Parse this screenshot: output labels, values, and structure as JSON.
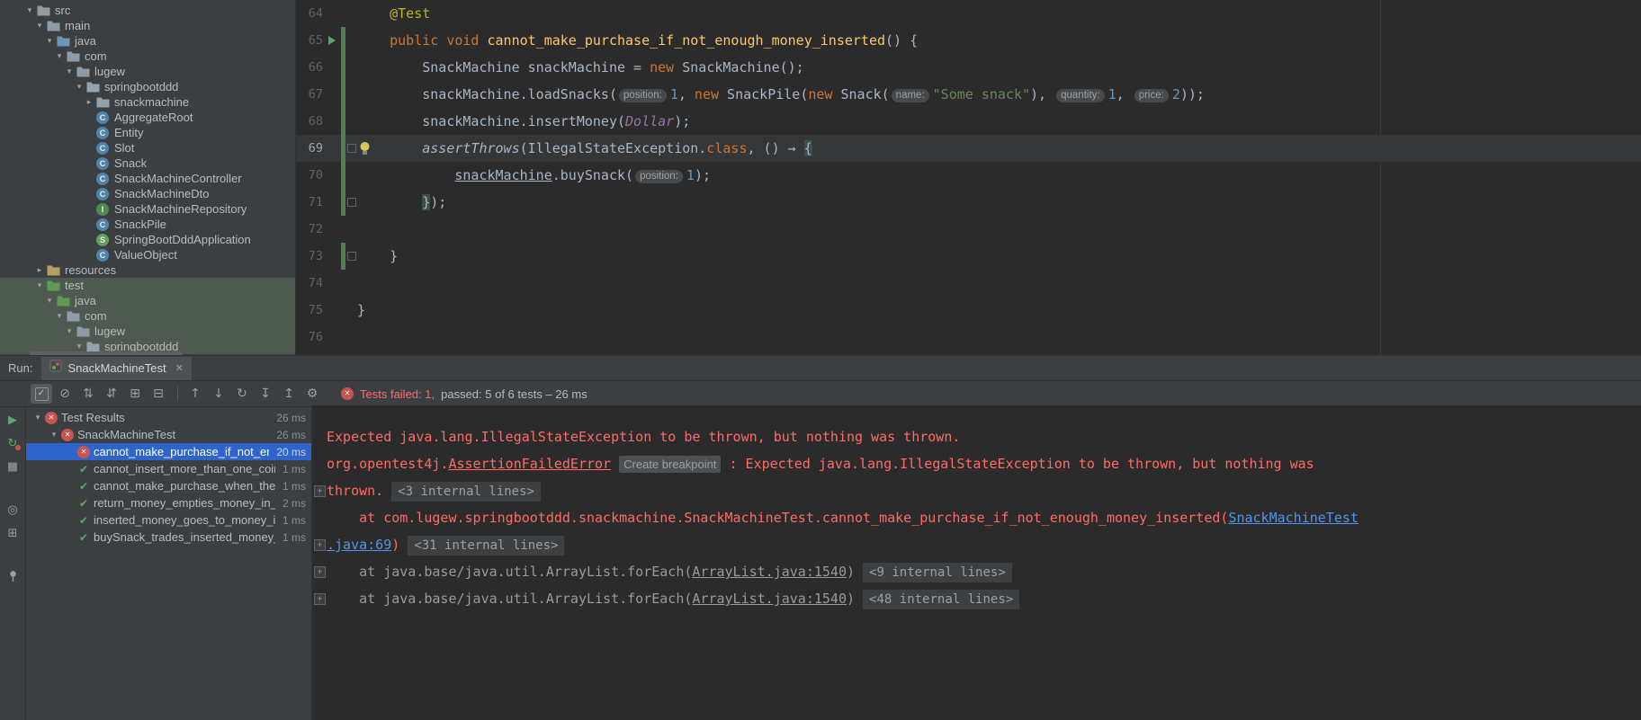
{
  "colors": {
    "error_red": "#ff6b68",
    "fail_icon_red": "#c75450",
    "pass_green": "#59a869",
    "selection_blue": "#2f65ca",
    "link_blue": "#5394ec",
    "vcs_added_green": "#537d53",
    "panel_bg": "#3c3f41",
    "editor_bg": "#2b2b2b"
  },
  "project_tree": {
    "rows": [
      {
        "label": "src",
        "level": 1,
        "arrow": "v",
        "icon": "folder"
      },
      {
        "label": "main",
        "level": 2,
        "arrow": "v",
        "icon": "folder"
      },
      {
        "label": "java",
        "level": 3,
        "arrow": "v",
        "icon": "folder-src"
      },
      {
        "label": "com",
        "level": 4,
        "arrow": "v",
        "icon": "folder"
      },
      {
        "label": "lugew",
        "level": 5,
        "arrow": "v",
        "icon": "folder"
      },
      {
        "label": "springbootddd",
        "level": 6,
        "arrow": "v",
        "icon": "package"
      },
      {
        "label": "snackmachine",
        "level": 7,
        "arrow": ">",
        "icon": "package"
      },
      {
        "label": "AggregateRoot",
        "level": 7,
        "arrow": "",
        "icon": "class"
      },
      {
        "label": "Entity",
        "level": 7,
        "arrow": "",
        "icon": "class"
      },
      {
        "label": "Slot",
        "level": 7,
        "arrow": "",
        "icon": "class"
      },
      {
        "label": "Snack",
        "level": 7,
        "arrow": "",
        "icon": "class"
      },
      {
        "label": "SnackMachineController",
        "level": 7,
        "arrow": "",
        "icon": "class"
      },
      {
        "label": "SnackMachineDto",
        "level": 7,
        "arrow": "",
        "icon": "class"
      },
      {
        "label": "SnackMachineRepository",
        "level": 7,
        "arrow": "",
        "icon": "interface"
      },
      {
        "label": "SnackPile",
        "level": 7,
        "arrow": "",
        "icon": "class"
      },
      {
        "label": "SpringBootDddApplication",
        "level": 7,
        "arrow": "",
        "icon": "spring"
      },
      {
        "label": "ValueObject",
        "level": 7,
        "arrow": "",
        "icon": "class"
      },
      {
        "label": "resources",
        "level": 2,
        "arrow": ">",
        "icon": "folder-res"
      },
      {
        "label": "test",
        "level": 2,
        "arrow": "v",
        "icon": "folder-test",
        "selected": true
      },
      {
        "label": "java",
        "level": 3,
        "arrow": "v",
        "icon": "folder-test",
        "selected": true
      },
      {
        "label": "com",
        "level": 4,
        "arrow": "v",
        "icon": "folder",
        "selected": true
      },
      {
        "label": "lugew",
        "level": 5,
        "arrow": "v",
        "icon": "folder",
        "selected": true
      },
      {
        "label": "springbootddd",
        "level": 6,
        "arrow": "v",
        "icon": "package",
        "selected": true
      }
    ]
  },
  "editor": {
    "lines": [
      {
        "num": "64",
        "segs": [
          [
            "    ",
            "p"
          ],
          [
            "@Test",
            "ann"
          ]
        ]
      },
      {
        "num": "65",
        "play": true,
        "vcs": true,
        "segs": [
          [
            "    ",
            "p"
          ],
          [
            "public void ",
            "kw"
          ],
          [
            "cannot_make_purchase_if_not_enough_money_inserted",
            "fn"
          ],
          [
            "() {",
            "p"
          ]
        ]
      },
      {
        "num": "66",
        "vcs": true,
        "segs": [
          [
            "        SnackMachine snackMachine = ",
            "p"
          ],
          [
            "new",
            "kw"
          ],
          [
            " SnackMachine();",
            "p"
          ]
        ]
      },
      {
        "num": "67",
        "vcs": true,
        "segs": [
          [
            "        snackMachine.loadSnacks(",
            "p"
          ],
          [
            "position:",
            "hint"
          ],
          [
            "1",
            "num"
          ],
          [
            ", ",
            "p"
          ],
          [
            "new",
            "kw"
          ],
          [
            " SnackPile(",
            "p"
          ],
          [
            "new",
            "kw"
          ],
          [
            " Snack(",
            "p"
          ],
          [
            "name:",
            "hint"
          ],
          [
            "\"Some snack\"",
            "str"
          ],
          [
            "), ",
            "p"
          ],
          [
            "quantity:",
            "hint"
          ],
          [
            "1",
            "num"
          ],
          [
            ", ",
            "p"
          ],
          [
            "price:",
            "hint"
          ],
          [
            "2",
            "num"
          ],
          [
            "));",
            "p"
          ]
        ]
      },
      {
        "num": "68",
        "vcs": true,
        "segs": [
          [
            "        snackMachine.insertMoney(",
            "p"
          ],
          [
            "Dollar",
            "sfield"
          ],
          [
            ");",
            "p"
          ]
        ]
      },
      {
        "num": "69",
        "vcs": true,
        "hl": true,
        "bulb": true,
        "fold": true,
        "segs": [
          [
            "        ",
            "p"
          ],
          [
            "assertThrows",
            "smethod"
          ],
          [
            "(IllegalStateException.",
            "p"
          ],
          [
            "class",
            "kw"
          ],
          [
            ", () → ",
            "p"
          ],
          [
            "{",
            "bhl"
          ]
        ]
      },
      {
        "num": "70",
        "vcs": true,
        "segs": [
          [
            "            ",
            "p"
          ],
          [
            "snackMachine",
            "ul"
          ],
          [
            ".buySnack(",
            "p"
          ],
          [
            "position:",
            "hint"
          ],
          [
            "1",
            "num"
          ],
          [
            ");",
            "p"
          ]
        ]
      },
      {
        "num": "71",
        "vcs": true,
        "fold": true,
        "segs": [
          [
            "        ",
            "p"
          ],
          [
            "}",
            "bhl"
          ],
          [
            ");",
            "p"
          ]
        ]
      },
      {
        "num": "72",
        "segs": []
      },
      {
        "num": "73",
        "vcs": true,
        "fold": true,
        "segs": [
          [
            "    }",
            "p"
          ]
        ]
      },
      {
        "num": "74",
        "segs": []
      },
      {
        "num": "75",
        "segs": [
          [
            "}",
            "p"
          ]
        ]
      },
      {
        "num": "76",
        "segs": []
      }
    ]
  },
  "run": {
    "label": "Run:",
    "tab": {
      "title": "SnackMachineTest",
      "close": "✕"
    },
    "status": {
      "failed": "Tests failed: 1,",
      "passed": " passed: 5 of 6 tests – 26 ms"
    },
    "toolbar": {
      "icons": [
        {
          "name": "show-passed",
          "glyph": "✓",
          "kind": "checkbox",
          "toggled": true
        },
        {
          "name": "show-ignored",
          "glyph": "⊘"
        },
        {
          "name": "sort-by-duration",
          "glyph": "⇅"
        },
        {
          "name": "sort-alphabetically",
          "glyph": "⇵"
        },
        {
          "name": "expand-all",
          "glyph": "⊞"
        },
        {
          "name": "collapse-all",
          "glyph": "⊟"
        },
        {
          "name": "separator",
          "glyph": ""
        },
        {
          "name": "previous-failed-test",
          "glyph": "↑"
        },
        {
          "name": "next-failed-test",
          "glyph": "↓"
        },
        {
          "name": "test-history",
          "glyph": "↻"
        },
        {
          "name": "import-test-results",
          "glyph": "↧"
        },
        {
          "name": "export-test-results",
          "glyph": "↥"
        },
        {
          "name": "settings-gear",
          "glyph": "⚙"
        }
      ]
    },
    "strip": [
      {
        "name": "rerun",
        "glyph": "▶",
        "color": "green"
      },
      {
        "name": "rerun-failed-tests",
        "glyph": "↻",
        "color": "green",
        "dot": true
      },
      {
        "name": "stop",
        "glyph": "■",
        "color": "grey"
      },
      {
        "name": "gap"
      },
      {
        "name": "toggle-auto-test",
        "glyph": "◎"
      },
      {
        "name": "run-dashboard",
        "glyph": "⊞"
      },
      {
        "name": "gap"
      },
      {
        "name": "pin-tab",
        "glyph": "pin"
      }
    ],
    "tree": {
      "rows": [
        {
          "label": "Test Results",
          "time": "26 ms",
          "icon": "fail",
          "level": 0,
          "arrow": true
        },
        {
          "label": "SnackMachineTest",
          "time": "26 ms",
          "icon": "fail",
          "level": 1,
          "arrow": true
        },
        {
          "label": "cannot_make_purchase_if_not_enough_mone",
          "time": "20 ms",
          "icon": "fail",
          "level": 2,
          "selected": true
        },
        {
          "label": "cannot_insert_more_than_one_coin_or_note_a",
          "time": "1 ms",
          "icon": "pass",
          "level": 2
        },
        {
          "label": "cannot_make_purchase_when_there_is_no_sna",
          "time": "1 ms",
          "icon": "pass",
          "level": 2
        },
        {
          "label": "return_money_empties_money_in_transaction",
          "time": "2 ms",
          "icon": "pass",
          "level": 2
        },
        {
          "label": "inserted_money_goes_to_money_in_transactic",
          "time": "1 ms",
          "icon": "pass",
          "level": 2
        },
        {
          "label": "buySnack_trades_inserted_money_for_a_snacl",
          "time": "1 ms",
          "icon": "pass",
          "level": 2
        }
      ]
    },
    "console": {
      "lines": [
        {
          "fold": false,
          "segs": [
            [
              "Expected java.lang.IllegalStateException to be thrown, but nothing was thrown.",
              "err"
            ]
          ]
        },
        {
          "fold": false,
          "segs": [
            [
              "org.opentest4j.",
              "err"
            ],
            [
              "AssertionFailedError",
              "erru"
            ],
            [
              " ",
              "p"
            ],
            [
              "Create breakpoint",
              "crumb"
            ],
            [
              " : Expected java.lang.IllegalStateException to be thrown, but nothing was",
              "err"
            ]
          ]
        },
        {
          "fold": true,
          "segs": [
            [
              "thrown. ",
              "err"
            ],
            [
              "<3 internal lines>",
              "badge"
            ]
          ]
        },
        {
          "fold": false,
          "segs": [
            [
              "    at com.lugew.springbootddd.snackmachine.SnackMachineTest.cannot_make_purchase_if_not_enough_money_inserted(",
              "err"
            ],
            [
              "SnackMachineTest",
              "link"
            ]
          ]
        },
        {
          "fold": true,
          "segs": [
            [
              ".java:69",
              "link"
            ],
            [
              ")",
              "err"
            ],
            [
              " ",
              "p"
            ],
            [
              "<31 internal lines>",
              "badge"
            ]
          ]
        },
        {
          "fold": true,
          "segs": [
            [
              "    at java.base/java.util.ArrayList.forEach(",
              "dim"
            ],
            [
              "ArrayList.java:1540",
              "dimu"
            ],
            [
              ")",
              "dim"
            ],
            [
              " ",
              "p"
            ],
            [
              "<9 internal lines>",
              "badge"
            ]
          ]
        },
        {
          "fold": true,
          "segs": [
            [
              "    at java.base/java.util.ArrayList.forEach(",
              "dim"
            ],
            [
              "ArrayList.java:1540",
              "dimu"
            ],
            [
              ")",
              "dim"
            ],
            [
              " ",
              "p"
            ],
            [
              "<48 internal lines>",
              "badge"
            ]
          ]
        }
      ]
    }
  }
}
